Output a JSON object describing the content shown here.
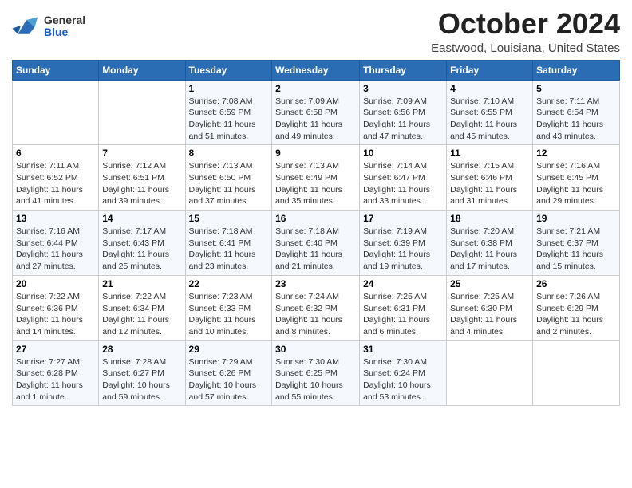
{
  "header": {
    "logo": {
      "general": "General",
      "blue": "Blue"
    },
    "title": "October 2024",
    "location": "Eastwood, Louisiana, United States"
  },
  "weekdays": [
    "Sunday",
    "Monday",
    "Tuesday",
    "Wednesday",
    "Thursday",
    "Friday",
    "Saturday"
  ],
  "weeks": [
    [
      {
        "day": "",
        "info": ""
      },
      {
        "day": "",
        "info": ""
      },
      {
        "day": "1",
        "info": "Sunrise: 7:08 AM\nSunset: 6:59 PM\nDaylight: 11 hours and 51 minutes."
      },
      {
        "day": "2",
        "info": "Sunrise: 7:09 AM\nSunset: 6:58 PM\nDaylight: 11 hours and 49 minutes."
      },
      {
        "day": "3",
        "info": "Sunrise: 7:09 AM\nSunset: 6:56 PM\nDaylight: 11 hours and 47 minutes."
      },
      {
        "day": "4",
        "info": "Sunrise: 7:10 AM\nSunset: 6:55 PM\nDaylight: 11 hours and 45 minutes."
      },
      {
        "day": "5",
        "info": "Sunrise: 7:11 AM\nSunset: 6:54 PM\nDaylight: 11 hours and 43 minutes."
      }
    ],
    [
      {
        "day": "6",
        "info": "Sunrise: 7:11 AM\nSunset: 6:52 PM\nDaylight: 11 hours and 41 minutes."
      },
      {
        "day": "7",
        "info": "Sunrise: 7:12 AM\nSunset: 6:51 PM\nDaylight: 11 hours and 39 minutes."
      },
      {
        "day": "8",
        "info": "Sunrise: 7:13 AM\nSunset: 6:50 PM\nDaylight: 11 hours and 37 minutes."
      },
      {
        "day": "9",
        "info": "Sunrise: 7:13 AM\nSunset: 6:49 PM\nDaylight: 11 hours and 35 minutes."
      },
      {
        "day": "10",
        "info": "Sunrise: 7:14 AM\nSunset: 6:47 PM\nDaylight: 11 hours and 33 minutes."
      },
      {
        "day": "11",
        "info": "Sunrise: 7:15 AM\nSunset: 6:46 PM\nDaylight: 11 hours and 31 minutes."
      },
      {
        "day": "12",
        "info": "Sunrise: 7:16 AM\nSunset: 6:45 PM\nDaylight: 11 hours and 29 minutes."
      }
    ],
    [
      {
        "day": "13",
        "info": "Sunrise: 7:16 AM\nSunset: 6:44 PM\nDaylight: 11 hours and 27 minutes."
      },
      {
        "day": "14",
        "info": "Sunrise: 7:17 AM\nSunset: 6:43 PM\nDaylight: 11 hours and 25 minutes."
      },
      {
        "day": "15",
        "info": "Sunrise: 7:18 AM\nSunset: 6:41 PM\nDaylight: 11 hours and 23 minutes."
      },
      {
        "day": "16",
        "info": "Sunrise: 7:18 AM\nSunset: 6:40 PM\nDaylight: 11 hours and 21 minutes."
      },
      {
        "day": "17",
        "info": "Sunrise: 7:19 AM\nSunset: 6:39 PM\nDaylight: 11 hours and 19 minutes."
      },
      {
        "day": "18",
        "info": "Sunrise: 7:20 AM\nSunset: 6:38 PM\nDaylight: 11 hours and 17 minutes."
      },
      {
        "day": "19",
        "info": "Sunrise: 7:21 AM\nSunset: 6:37 PM\nDaylight: 11 hours and 15 minutes."
      }
    ],
    [
      {
        "day": "20",
        "info": "Sunrise: 7:22 AM\nSunset: 6:36 PM\nDaylight: 11 hours and 14 minutes."
      },
      {
        "day": "21",
        "info": "Sunrise: 7:22 AM\nSunset: 6:34 PM\nDaylight: 11 hours and 12 minutes."
      },
      {
        "day": "22",
        "info": "Sunrise: 7:23 AM\nSunset: 6:33 PM\nDaylight: 11 hours and 10 minutes."
      },
      {
        "day": "23",
        "info": "Sunrise: 7:24 AM\nSunset: 6:32 PM\nDaylight: 11 hours and 8 minutes."
      },
      {
        "day": "24",
        "info": "Sunrise: 7:25 AM\nSunset: 6:31 PM\nDaylight: 11 hours and 6 minutes."
      },
      {
        "day": "25",
        "info": "Sunrise: 7:25 AM\nSunset: 6:30 PM\nDaylight: 11 hours and 4 minutes."
      },
      {
        "day": "26",
        "info": "Sunrise: 7:26 AM\nSunset: 6:29 PM\nDaylight: 11 hours and 2 minutes."
      }
    ],
    [
      {
        "day": "27",
        "info": "Sunrise: 7:27 AM\nSunset: 6:28 PM\nDaylight: 11 hours and 1 minute."
      },
      {
        "day": "28",
        "info": "Sunrise: 7:28 AM\nSunset: 6:27 PM\nDaylight: 10 hours and 59 minutes."
      },
      {
        "day": "29",
        "info": "Sunrise: 7:29 AM\nSunset: 6:26 PM\nDaylight: 10 hours and 57 minutes."
      },
      {
        "day": "30",
        "info": "Sunrise: 7:30 AM\nSunset: 6:25 PM\nDaylight: 10 hours and 55 minutes."
      },
      {
        "day": "31",
        "info": "Sunrise: 7:30 AM\nSunset: 6:24 PM\nDaylight: 10 hours and 53 minutes."
      },
      {
        "day": "",
        "info": ""
      },
      {
        "day": "",
        "info": ""
      }
    ]
  ]
}
